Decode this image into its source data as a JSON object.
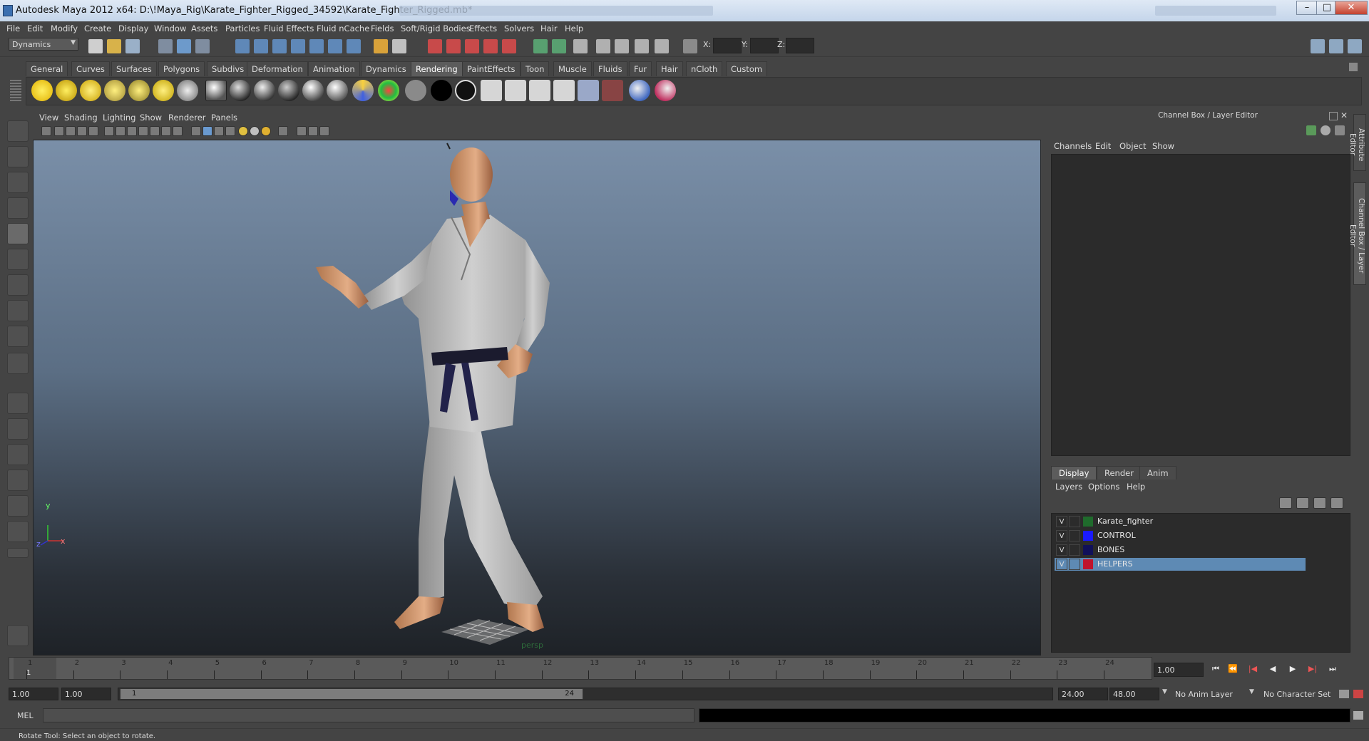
{
  "window": {
    "title": "Autodesk Maya 2012 x64: D:\\!Maya_Rig\\Karate_Fighter_Rigged_34592\\Karate_Fighter_Rigged.mb*",
    "minimize": "–",
    "maximize": "□",
    "close": "✕"
  },
  "menubar": [
    "File",
    "Edit",
    "Modify",
    "Create",
    "Display",
    "Window",
    "Assets",
    "Particles",
    "Fluid Effects",
    "Fluid nCache",
    "Fields",
    "Soft/Rigid Bodies",
    "Effects",
    "Solvers",
    "Hair",
    "Help"
  ],
  "statusline": {
    "menuset": "Dynamics",
    "x_label": "X:",
    "y_label": "Y:",
    "z_label": "Z:"
  },
  "shelf_tabs": [
    "General",
    "Curves",
    "Surfaces",
    "Polygons",
    "Subdivs",
    "Deformation",
    "Animation",
    "Dynamics",
    "Rendering",
    "PaintEffects",
    "Toon",
    "Muscle",
    "Fluids",
    "Fur",
    "Hair",
    "nCloth",
    "Custom"
  ],
  "active_shelf_tab": "Rendering",
  "viewport": {
    "menu": [
      "View",
      "Shading",
      "Lighting",
      "Show",
      "Renderer",
      "Panels"
    ],
    "camera_label": "persp",
    "axis_y": "y",
    "axis_x": "x",
    "axis_z": "z"
  },
  "channel_box": {
    "header": "Channel Box / Layer Editor",
    "menu": [
      "Channels",
      "Edit",
      "Object",
      "Show"
    ]
  },
  "side_tabs": [
    "Attribute Editor",
    "Channel Box / Layer Editor"
  ],
  "layer_editor": {
    "tabs": [
      "Display",
      "Render",
      "Anim"
    ],
    "active_tab": "Display",
    "menu": [
      "Layers",
      "Options",
      "Help"
    ],
    "layers": [
      {
        "visible": "V",
        "name": "Karate_fighter",
        "color": "#1f6b2c",
        "selected": false
      },
      {
        "visible": "V",
        "name": "CONTROL",
        "color": "#1a1aff",
        "selected": false
      },
      {
        "visible": "V",
        "name": "BONES",
        "color": "#10105a",
        "selected": false
      },
      {
        "visible": "V",
        "name": "HELPERS",
        "color": "#c0142c",
        "selected": true
      }
    ]
  },
  "timeline": {
    "frames": [
      "1",
      "2",
      "3",
      "4",
      "5",
      "6",
      "7",
      "8",
      "9",
      "10",
      "11",
      "12",
      "13",
      "14",
      "15",
      "16",
      "17",
      "18",
      "19",
      "20",
      "21",
      "22",
      "23",
      "24"
    ],
    "current_frame_marker": "1",
    "current_time": "1.00"
  },
  "playback": {
    "go_start": "⏮",
    "step_back_key": "⏪",
    "step_back": "|◀",
    "play_back": "◀",
    "play_fwd": "▶",
    "step_fwd": "▶|",
    "go_end": "⏭"
  },
  "range": {
    "start_time": "1.00",
    "playback_start": "1.00",
    "range_start_label": "1",
    "range_end_label": "24",
    "playback_end": "24.00",
    "end_time": "48.00",
    "anim_layer": "No Anim Layer",
    "character_set": "No Character Set"
  },
  "commandline": {
    "label": "MEL"
  },
  "helpline": {
    "text": "Rotate Tool: Select an object to rotate."
  }
}
